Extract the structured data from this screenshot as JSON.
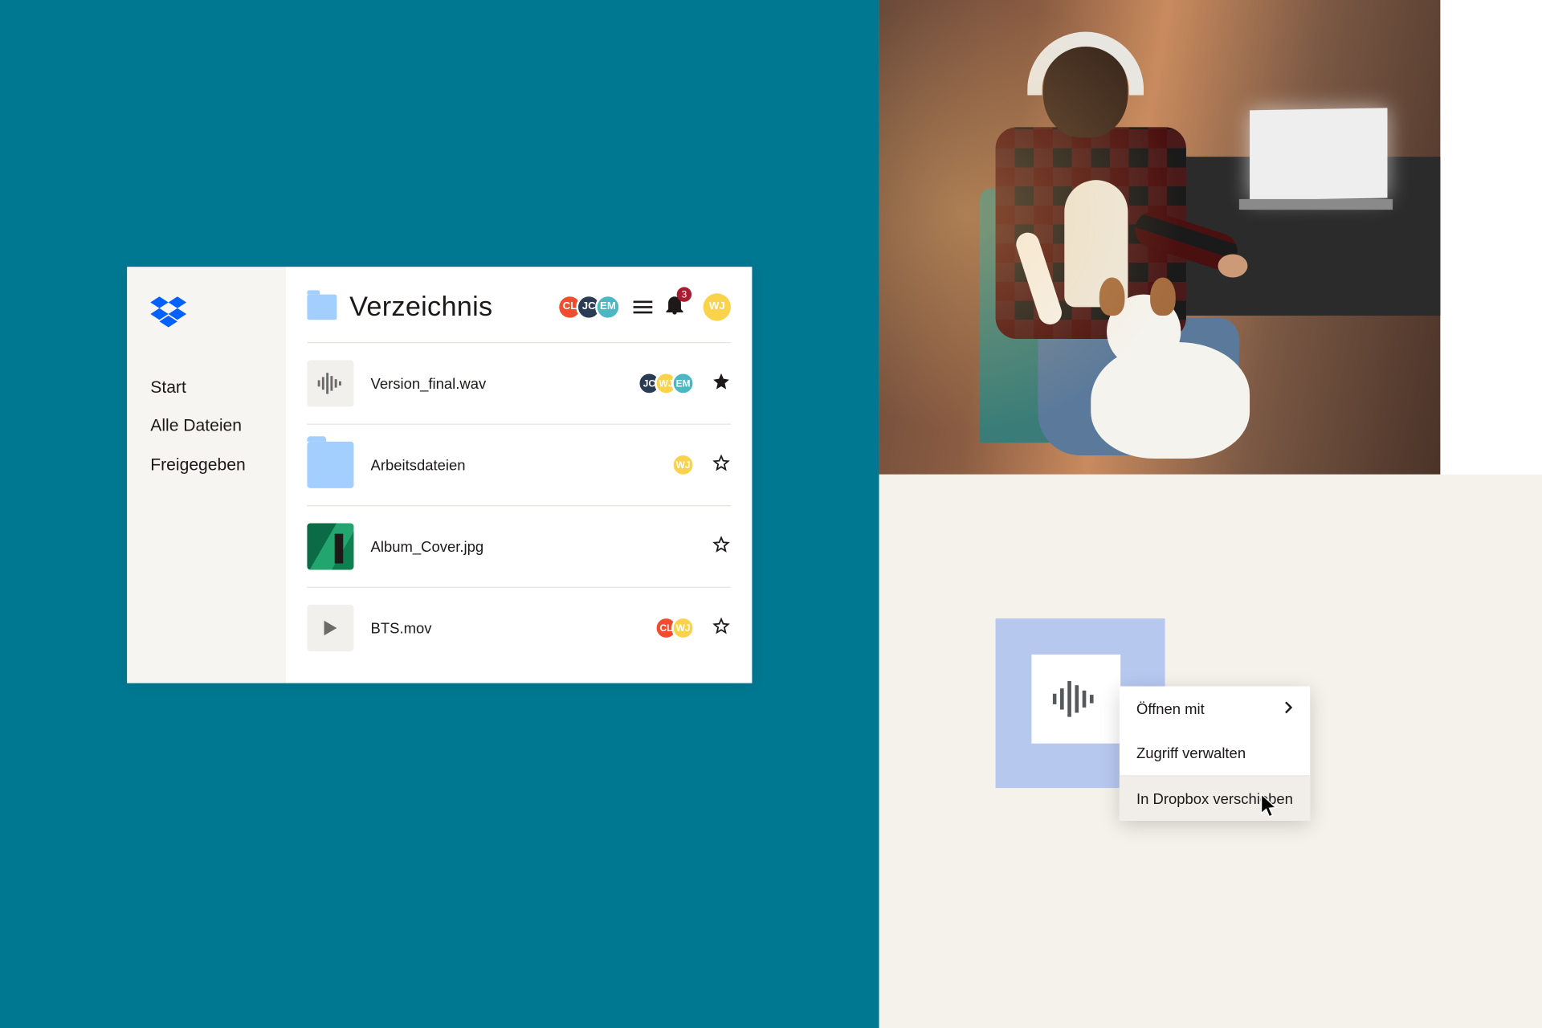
{
  "sidebar": {
    "items": [
      {
        "label": "Start"
      },
      {
        "label": "Alle Dateien"
      },
      {
        "label": "Freigegeben"
      }
    ]
  },
  "header": {
    "title": "Verzeichnis",
    "shared_avatars": [
      {
        "initials": "CL",
        "color": "#ef4d2e"
      },
      {
        "initials": "JC",
        "color": "#2a3b54"
      },
      {
        "initials": "EM",
        "color": "#4bb7c3"
      }
    ],
    "notification_count": "3",
    "profile_initials": "WJ"
  },
  "files": [
    {
      "name": "Version_final.wav",
      "icon": "audio",
      "avatars": [
        {
          "initials": "JC",
          "color": "#2a3b54"
        },
        {
          "initials": "WJ",
          "color": "#fad24b"
        },
        {
          "initials": "EM",
          "color": "#4bb7c3"
        }
      ],
      "starred": true
    },
    {
      "name": "Arbeitsdateien",
      "icon": "folder",
      "avatars": [
        {
          "initials": "WJ",
          "color": "#fad24b"
        }
      ],
      "starred": false
    },
    {
      "name": "Album_Cover.jpg",
      "icon": "image",
      "avatars": [],
      "starred": false
    },
    {
      "name": "BTS.mov",
      "icon": "video",
      "avatars": [
        {
          "initials": "CL",
          "color": "#ef4d2e"
        },
        {
          "initials": "WJ",
          "color": "#fad24b"
        }
      ],
      "starred": false
    }
  ],
  "context_menu": {
    "items": [
      {
        "label": "Öffnen mit",
        "submenu": true
      },
      {
        "label": "Zugriff verwalten",
        "submenu": false
      },
      {
        "label": "In Dropbox verschieben",
        "submenu": false
      }
    ]
  }
}
